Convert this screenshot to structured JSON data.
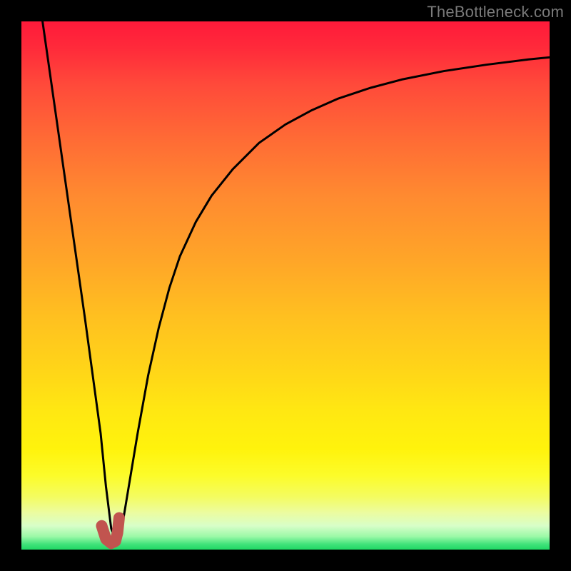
{
  "watermark": "TheBottleneck.com",
  "chart_data": {
    "type": "line",
    "title": "",
    "xlabel": "",
    "ylabel": "",
    "xlim": [
      0,
      100
    ],
    "ylim": [
      0,
      100
    ],
    "grid": false,
    "legend": false,
    "background_gradient_top": "#ff1a3a",
    "background_gradient_bottom": "#20d864",
    "series": [
      {
        "name": "bottleneck-curve",
        "color": "#000000",
        "stroke_width": 3,
        "x": [
          4,
          6,
          8,
          10,
          12,
          13.5,
          15,
          16,
          17,
          18,
          19,
          20,
          22,
          24,
          26,
          28,
          30,
          33,
          36,
          40,
          45,
          50,
          55,
          60,
          66,
          72,
          80,
          88,
          96,
          100
        ],
        "y": [
          100,
          86,
          72,
          58,
          44,
          33,
          22,
          12,
          4,
          1.5,
          4,
          10,
          22,
          33,
          42,
          49.5,
          55.5,
          62,
          67,
          72,
          77,
          80.5,
          83.2,
          85.4,
          87.4,
          89.0,
          90.6,
          91.8,
          92.8,
          93.2
        ]
      },
      {
        "name": "highlight-marker",
        "color": "#c1544f",
        "stroke_width": 16,
        "linecap": "round",
        "x": [
          15.2,
          16.0,
          17.0,
          17.8,
          18.2,
          18.5
        ],
        "y": [
          4.5,
          2.0,
          1.2,
          1.6,
          3.2,
          6.0
        ]
      }
    ]
  }
}
